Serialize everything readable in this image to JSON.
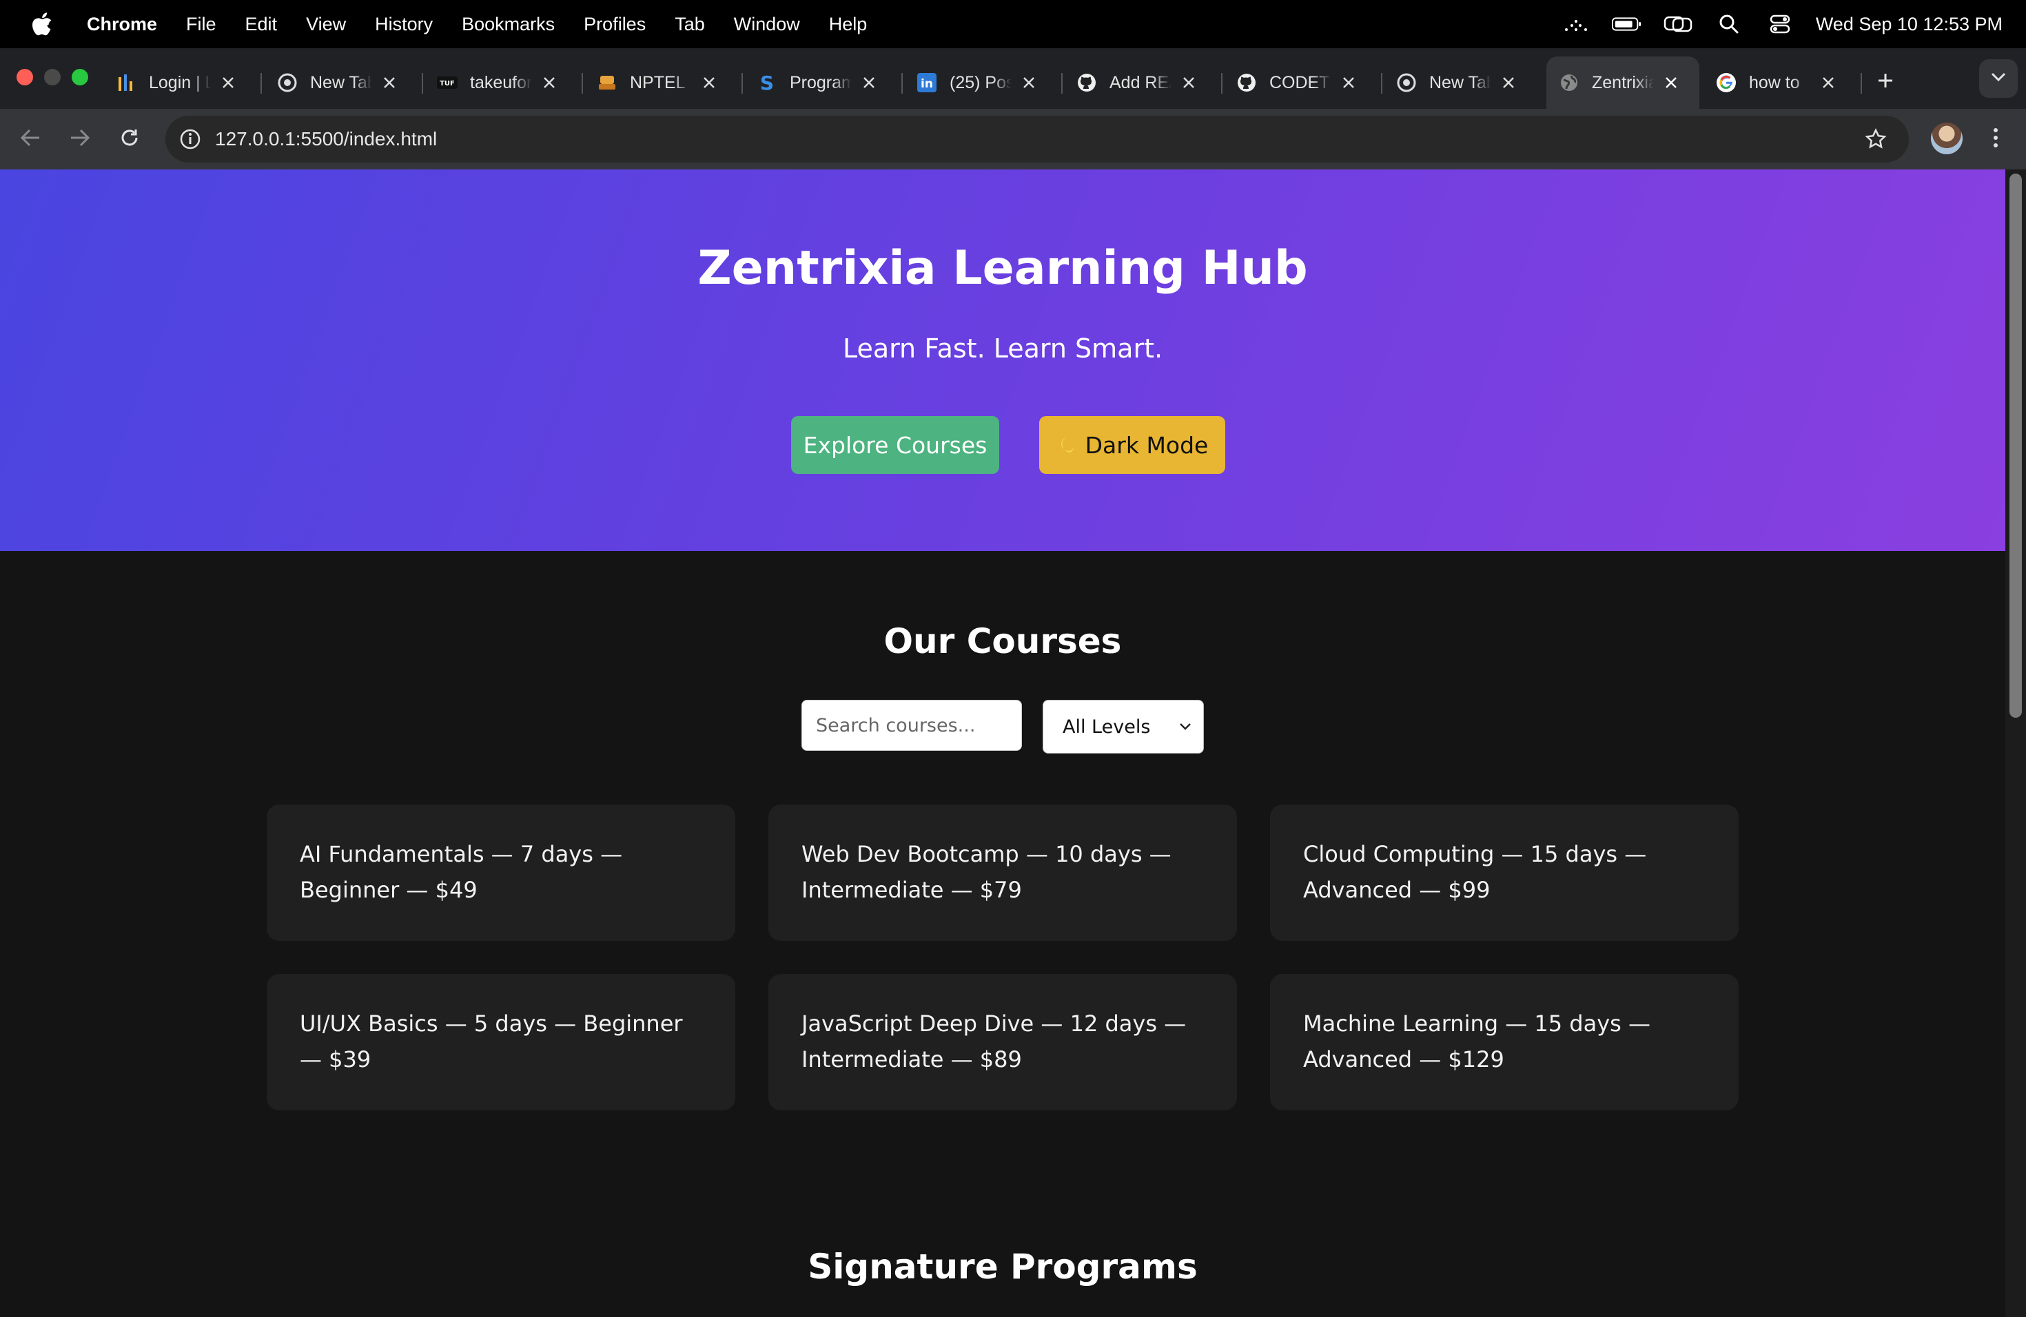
{
  "menubar": {
    "app": "Chrome",
    "items": [
      "File",
      "Edit",
      "View",
      "History",
      "Bookmarks",
      "Profiles",
      "Tab",
      "Window",
      "Help"
    ],
    "clock": "Wed Sep 10  12:53 PM"
  },
  "tabs": [
    {
      "title": "Login | L",
      "icon": "chart-bars-icon"
    },
    {
      "title": "New Tab",
      "icon": "chrome-icon"
    },
    {
      "title": "takeuforward",
      "icon": "tuf-icon"
    },
    {
      "title": "NPTEL",
      "icon": "nptel-icon"
    },
    {
      "title": "Programiz",
      "icon": "s-logo-icon"
    },
    {
      "title": "(25) Posts",
      "icon": "linkedin-icon"
    },
    {
      "title": "Add README",
      "icon": "github-icon"
    },
    {
      "title": "CODETECH",
      "icon": "github-icon"
    },
    {
      "title": "New Tab",
      "icon": "chrome-icon"
    },
    {
      "title": "Zentrixia",
      "icon": "globe-icon",
      "active": true
    },
    {
      "title": "how to",
      "icon": "google-icon"
    }
  ],
  "toolbar": {
    "url": "127.0.0.1:5500/index.html"
  },
  "hero": {
    "title": "Zentrixia Learning Hub",
    "tagline": "Learn Fast. Learn Smart.",
    "explore_label": "Explore Courses",
    "dark_label": "Dark Mode"
  },
  "courses": {
    "title": "Our Courses",
    "search_placeholder": "Search courses...",
    "level_selected": "All Levels",
    "items": [
      "AI Fundamentals — 7 days — Beginner — $49",
      "Web Dev Bootcamp — 10 days — Intermediate — $79",
      "Cloud Computing — 15 days — Advanced — $99",
      "UI/UX Basics — 5 days — Beginner — $39",
      "JavaScript Deep Dive — 12 days — Intermediate — $89",
      "Machine Learning — 15 days — Advanced — $129"
    ]
  },
  "signature": {
    "title": "Signature Programs"
  },
  "colors": {
    "hero_start": "#4a45e0",
    "hero_end": "#8a3fe0",
    "explore_button": "#4db380",
    "dark_button": "#e8b633",
    "page_bg": "#141414",
    "card_bg": "#202020"
  }
}
